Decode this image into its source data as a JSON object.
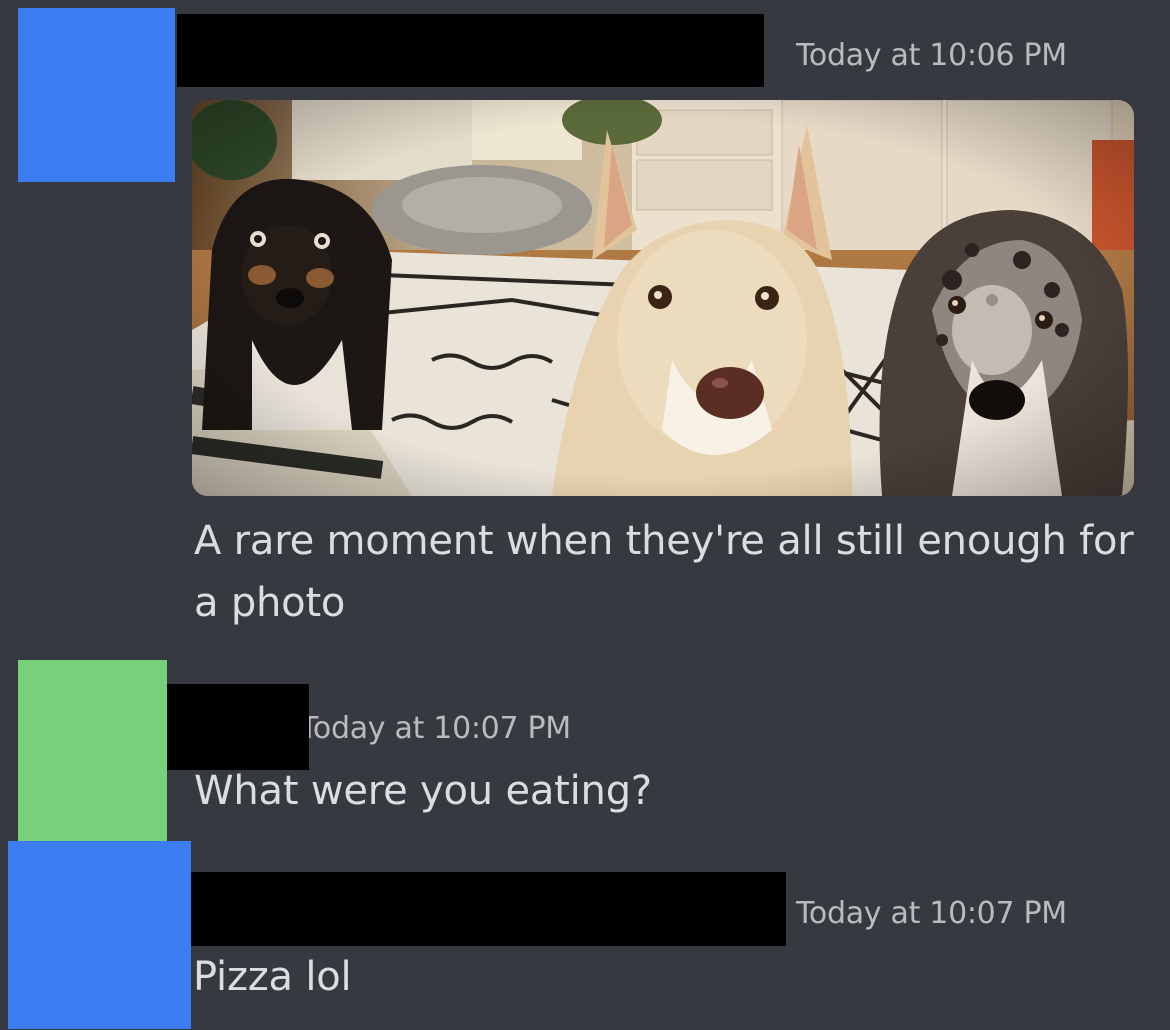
{
  "messages": [
    {
      "timestamp": "Today at 10:06 PM",
      "text": "A rare moment when they're all still enough for a photo",
      "attachment": {
        "type": "photo",
        "subject": "three-dogs"
      },
      "avatar_color": "#3b7cf0"
    },
    {
      "timestamp": "Today at 10:07 PM",
      "text": "What were you eating?",
      "avatar_color": "#77d17a"
    },
    {
      "timestamp": "Today at 10:07 PM",
      "text": "Pizza lol",
      "avatar_color": "#3b7cf0"
    }
  ],
  "theme": {
    "background": "#36393f",
    "text": "#dcddde",
    "muted": "#b9bbbe",
    "redaction": "#000000"
  }
}
